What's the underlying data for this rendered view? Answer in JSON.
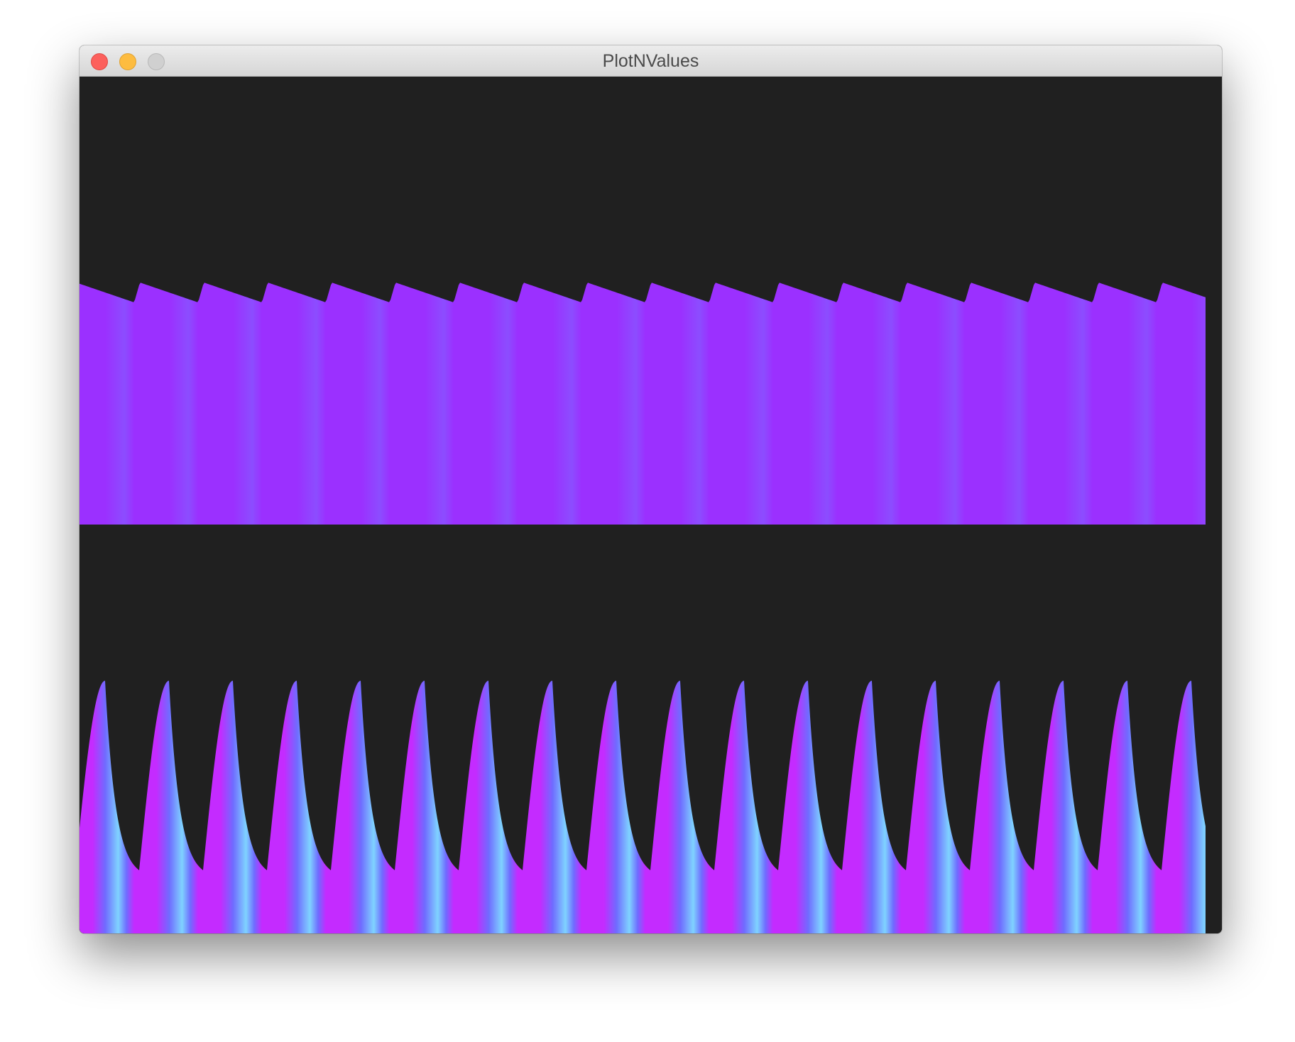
{
  "window": {
    "title": "PlotNValues"
  },
  "colors": {
    "background": "#202020",
    "titlebar": "#e2e2e2",
    "close": "#fc605c",
    "minimize": "#fdbc40",
    "zoom": "#d0d0d0",
    "purple_a": "#9b30ff",
    "purple_b": "#8c4dff",
    "magenta": "#c42bff",
    "cyan": "#7fd3ff"
  },
  "icons": {
    "close": "close-traffic-light-icon",
    "minimize": "minimize-traffic-light-icon",
    "zoom": "zoom-traffic-light-icon"
  }
}
